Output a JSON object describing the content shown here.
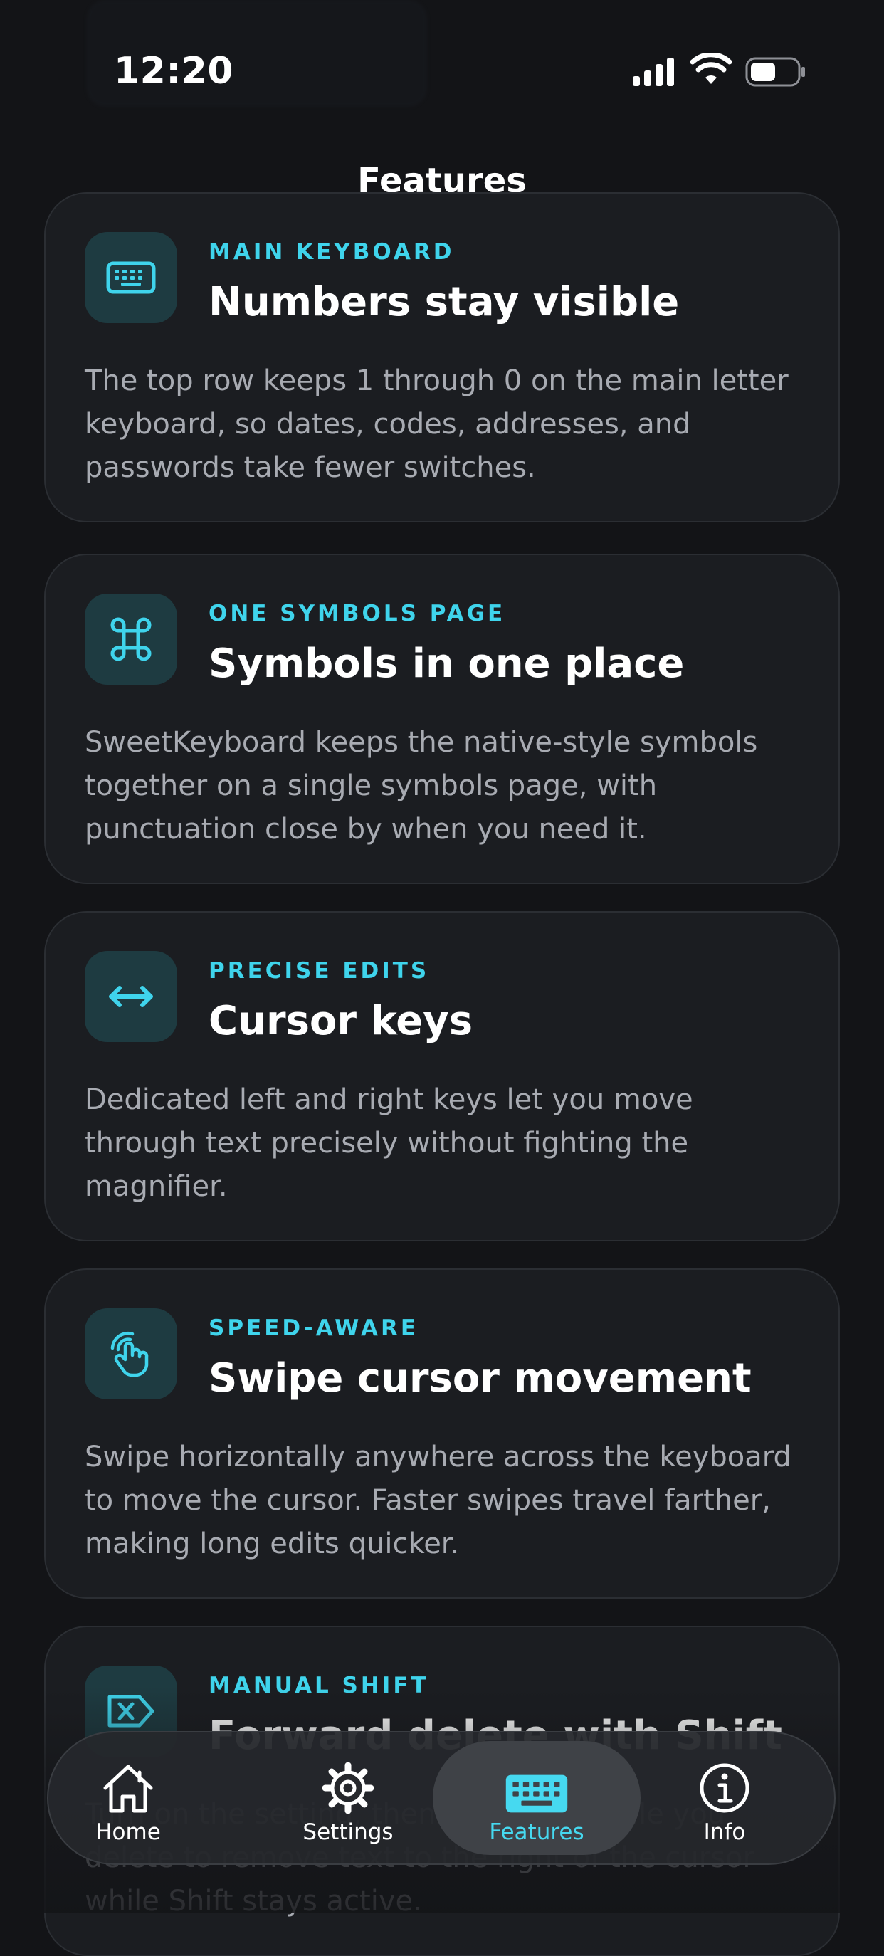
{
  "status_bar": {
    "time": "12:20"
  },
  "screen": {
    "title": "Features"
  },
  "features": [
    {
      "eyebrow": "MAIN KEYBOARD",
      "title": "Numbers stay visible",
      "body": "The top row keeps 1 through 0 on the main letter keyboard, so dates, codes, addresses, and passwords take fewer switches.",
      "icon": "keyboard-icon"
    },
    {
      "eyebrow": "ONE SYMBOLS PAGE",
      "title": "Symbols in one place",
      "body": "SweetKeyboard keeps the native-style symbols together on a single symbols page, with punctuation close by when you need it.",
      "icon": "command-icon"
    },
    {
      "eyebrow": "PRECISE EDITS",
      "title": "Cursor keys",
      "body": "Dedicated left and right keys let you move through text precisely without fighting the magnifier.",
      "icon": "left-right-arrow-icon"
    },
    {
      "eyebrow": "SPEED-AWARE",
      "title": "Swipe cursor movement",
      "body": "Swipe horizontally anywhere across the keyboard to move the cursor. Faster swipes travel farther, making long edits quicker.",
      "icon": "hand-swipe-icon"
    },
    {
      "eyebrow": "MANUAL SHIFT",
      "title": "Forward delete with Shift",
      "body": "Turn on the setting, then hold Shift while you delete to remove text to the right of the cursor while Shift stays active.",
      "icon": "forward-delete-icon"
    }
  ],
  "tab_bar": {
    "tabs": [
      {
        "label": "Home",
        "icon": "home-icon",
        "active": false
      },
      {
        "label": "Settings",
        "icon": "gear-icon",
        "active": false
      },
      {
        "label": "Features",
        "icon": "keyboard-icon",
        "active": true
      },
      {
        "label": "Info",
        "icon": "info-icon",
        "active": false
      }
    ]
  },
  "colors": {
    "background": "#131417",
    "card": "#1b1d21",
    "accent": "#3fd4ec",
    "body_text": "#a8abb2"
  }
}
